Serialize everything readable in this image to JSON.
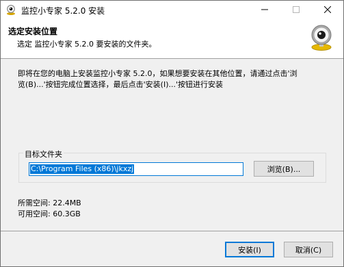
{
  "window": {
    "title": "监控小专家 5.2.0 安装",
    "min_icon": "minimize-icon",
    "max_icon": "maximize-icon",
    "close_icon": "close-icon"
  },
  "header": {
    "title": "选定安装位置",
    "subtitle": "选定 监控小专家 5.2.0 要安装的文件夹。",
    "icon": "webcam-icon"
  },
  "intro": {
    "line1": "即将在您的电脑上安装监控小专家 5.2.0，如果想要安装在其他位置，请通过点击'浏",
    "line2": "览(B)...'按钮完成位置选择，最后点击'安装(I)...'按钮进行安装"
  },
  "destination": {
    "group_label": "目标文件夹",
    "path_value": "C:\\Program Files (x86)\\jkxzj",
    "browse_label": "浏览(B)..."
  },
  "space": {
    "required": "所需空间: 22.4MB",
    "available": "可用空间: 60.3GB"
  },
  "buttons": {
    "install": "安装(I)",
    "cancel": "取消(C)"
  },
  "colors": {
    "accent": "#0078d7",
    "window_bg": "#f0f0f0",
    "header_bg": "#ffffff"
  }
}
